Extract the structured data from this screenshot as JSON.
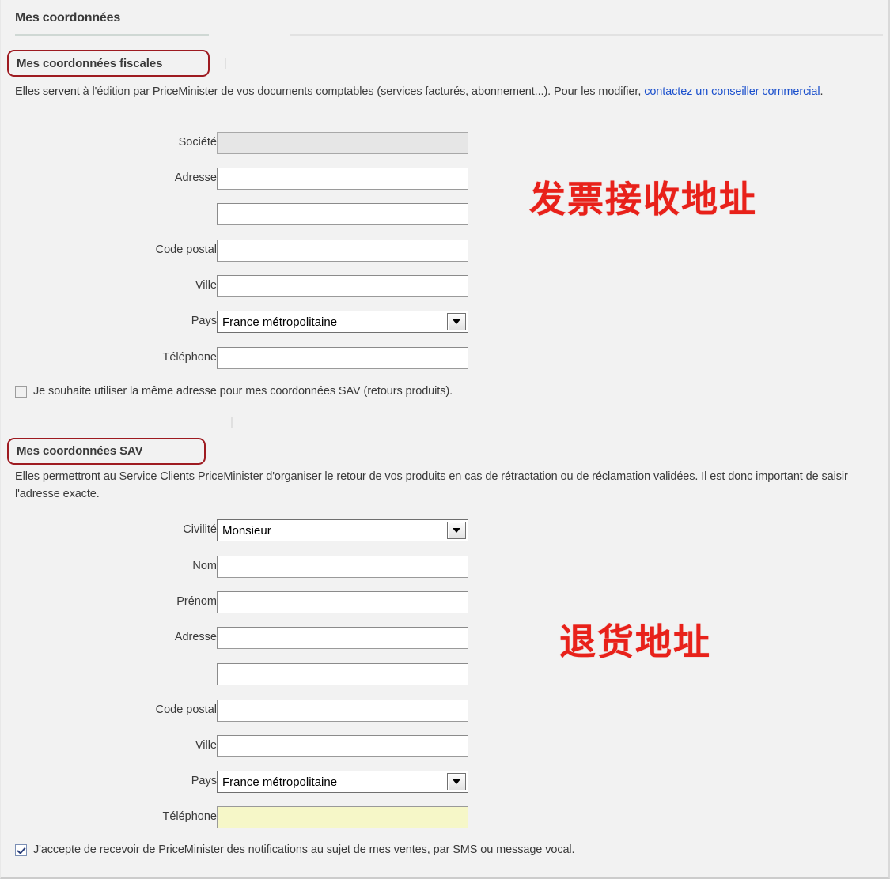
{
  "tab": {
    "title": "Mes coordonnées"
  },
  "fiscal_section": {
    "heading": "Mes coordonnées fiscales",
    "description_part1": "Elles servent à l'édition par PriceMinister de vos documents comptables (services facturés, abonnement...). Pour les modifier, ",
    "link_text": "contactez un conseiller commercial",
    "description_part2": ".",
    "fields": [
      {
        "label": "Société",
        "value": "",
        "type": "text",
        "state": "disabled"
      },
      {
        "label": "Adresse",
        "value": "",
        "type": "text",
        "state": "normal"
      },
      {
        "label": "",
        "value": "",
        "type": "text",
        "state": "normal"
      },
      {
        "label": "Code postal",
        "value": "",
        "type": "text",
        "state": "normal"
      },
      {
        "label": "Ville",
        "value": "",
        "type": "text",
        "state": "normal"
      },
      {
        "label": "Pays",
        "value": "France métropolitaine",
        "type": "select",
        "state": "normal"
      },
      {
        "label": "Téléphone",
        "value": "",
        "type": "text",
        "state": "normal"
      }
    ],
    "checkbox": {
      "label": "Je souhaite utiliser la même adresse pour mes coordonnées SAV (retours produits).",
      "checked": false
    }
  },
  "sav_section": {
    "heading": "Mes coordonnées SAV",
    "description": "Elles permettront au Service Clients PriceMinister d'organiser le retour de vos produits en cas de rétractation ou de réclamation validées. Il est donc important de saisir l'adresse exacte.",
    "fields": [
      {
        "label": "Civilité",
        "value": "Monsieur",
        "type": "select",
        "state": "normal"
      },
      {
        "label": "Nom",
        "value": "",
        "type": "text",
        "state": "normal"
      },
      {
        "label": "Prénom",
        "value": "",
        "type": "text",
        "state": "normal"
      },
      {
        "label": "Adresse",
        "value": "",
        "type": "text",
        "state": "normal"
      },
      {
        "label": "",
        "value": "",
        "type": "text",
        "state": "normal"
      },
      {
        "label": "Code postal",
        "value": "",
        "type": "text",
        "state": "normal"
      },
      {
        "label": "Ville",
        "value": "",
        "type": "text",
        "state": "normal"
      },
      {
        "label": "Pays",
        "value": "France métropolitaine",
        "type": "select",
        "state": "normal"
      },
      {
        "label": "Téléphone",
        "value": "",
        "type": "text",
        "state": "highlight"
      }
    ],
    "checkbox": {
      "label": "J'accepte de recevoir de PriceMinister des notifications au sujet de mes ventes, par SMS ou message vocal.",
      "checked": true
    }
  },
  "annotations": [
    {
      "text": "发票接收地址",
      "color": "#e8211a"
    },
    {
      "text": "退货地址",
      "color": "#e8211a"
    }
  ]
}
